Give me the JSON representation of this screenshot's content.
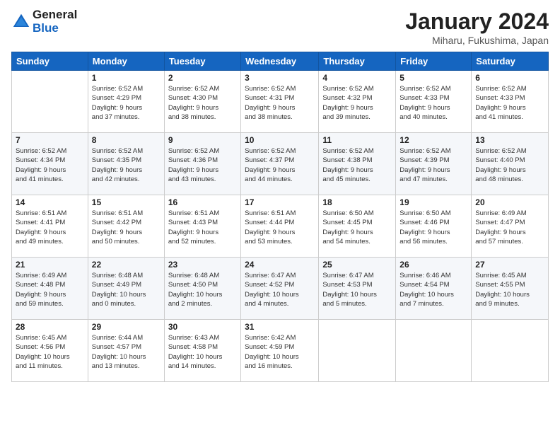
{
  "header": {
    "logo_line1": "General",
    "logo_line2": "Blue",
    "title": "January 2024",
    "subtitle": "Miharu, Fukushima, Japan"
  },
  "days_of_week": [
    "Sunday",
    "Monday",
    "Tuesday",
    "Wednesday",
    "Thursday",
    "Friday",
    "Saturday"
  ],
  "weeks": [
    [
      {
        "num": "",
        "info": ""
      },
      {
        "num": "1",
        "info": "Sunrise: 6:52 AM\nSunset: 4:29 PM\nDaylight: 9 hours\nand 37 minutes."
      },
      {
        "num": "2",
        "info": "Sunrise: 6:52 AM\nSunset: 4:30 PM\nDaylight: 9 hours\nand 38 minutes."
      },
      {
        "num": "3",
        "info": "Sunrise: 6:52 AM\nSunset: 4:31 PM\nDaylight: 9 hours\nand 38 minutes."
      },
      {
        "num": "4",
        "info": "Sunrise: 6:52 AM\nSunset: 4:32 PM\nDaylight: 9 hours\nand 39 minutes."
      },
      {
        "num": "5",
        "info": "Sunrise: 6:52 AM\nSunset: 4:33 PM\nDaylight: 9 hours\nand 40 minutes."
      },
      {
        "num": "6",
        "info": "Sunrise: 6:52 AM\nSunset: 4:33 PM\nDaylight: 9 hours\nand 41 minutes."
      }
    ],
    [
      {
        "num": "7",
        "info": "Sunrise: 6:52 AM\nSunset: 4:34 PM\nDaylight: 9 hours\nand 41 minutes."
      },
      {
        "num": "8",
        "info": "Sunrise: 6:52 AM\nSunset: 4:35 PM\nDaylight: 9 hours\nand 42 minutes."
      },
      {
        "num": "9",
        "info": "Sunrise: 6:52 AM\nSunset: 4:36 PM\nDaylight: 9 hours\nand 43 minutes."
      },
      {
        "num": "10",
        "info": "Sunrise: 6:52 AM\nSunset: 4:37 PM\nDaylight: 9 hours\nand 44 minutes."
      },
      {
        "num": "11",
        "info": "Sunrise: 6:52 AM\nSunset: 4:38 PM\nDaylight: 9 hours\nand 45 minutes."
      },
      {
        "num": "12",
        "info": "Sunrise: 6:52 AM\nSunset: 4:39 PM\nDaylight: 9 hours\nand 47 minutes."
      },
      {
        "num": "13",
        "info": "Sunrise: 6:52 AM\nSunset: 4:40 PM\nDaylight: 9 hours\nand 48 minutes."
      }
    ],
    [
      {
        "num": "14",
        "info": "Sunrise: 6:51 AM\nSunset: 4:41 PM\nDaylight: 9 hours\nand 49 minutes."
      },
      {
        "num": "15",
        "info": "Sunrise: 6:51 AM\nSunset: 4:42 PM\nDaylight: 9 hours\nand 50 minutes."
      },
      {
        "num": "16",
        "info": "Sunrise: 6:51 AM\nSunset: 4:43 PM\nDaylight: 9 hours\nand 52 minutes."
      },
      {
        "num": "17",
        "info": "Sunrise: 6:51 AM\nSunset: 4:44 PM\nDaylight: 9 hours\nand 53 minutes."
      },
      {
        "num": "18",
        "info": "Sunrise: 6:50 AM\nSunset: 4:45 PM\nDaylight: 9 hours\nand 54 minutes."
      },
      {
        "num": "19",
        "info": "Sunrise: 6:50 AM\nSunset: 4:46 PM\nDaylight: 9 hours\nand 56 minutes."
      },
      {
        "num": "20",
        "info": "Sunrise: 6:49 AM\nSunset: 4:47 PM\nDaylight: 9 hours\nand 57 minutes."
      }
    ],
    [
      {
        "num": "21",
        "info": "Sunrise: 6:49 AM\nSunset: 4:48 PM\nDaylight: 9 hours\nand 59 minutes."
      },
      {
        "num": "22",
        "info": "Sunrise: 6:48 AM\nSunset: 4:49 PM\nDaylight: 10 hours\nand 0 minutes."
      },
      {
        "num": "23",
        "info": "Sunrise: 6:48 AM\nSunset: 4:50 PM\nDaylight: 10 hours\nand 2 minutes."
      },
      {
        "num": "24",
        "info": "Sunrise: 6:47 AM\nSunset: 4:52 PM\nDaylight: 10 hours\nand 4 minutes."
      },
      {
        "num": "25",
        "info": "Sunrise: 6:47 AM\nSunset: 4:53 PM\nDaylight: 10 hours\nand 5 minutes."
      },
      {
        "num": "26",
        "info": "Sunrise: 6:46 AM\nSunset: 4:54 PM\nDaylight: 10 hours\nand 7 minutes."
      },
      {
        "num": "27",
        "info": "Sunrise: 6:45 AM\nSunset: 4:55 PM\nDaylight: 10 hours\nand 9 minutes."
      }
    ],
    [
      {
        "num": "28",
        "info": "Sunrise: 6:45 AM\nSunset: 4:56 PM\nDaylight: 10 hours\nand 11 minutes."
      },
      {
        "num": "29",
        "info": "Sunrise: 6:44 AM\nSunset: 4:57 PM\nDaylight: 10 hours\nand 13 minutes."
      },
      {
        "num": "30",
        "info": "Sunrise: 6:43 AM\nSunset: 4:58 PM\nDaylight: 10 hours\nand 14 minutes."
      },
      {
        "num": "31",
        "info": "Sunrise: 6:42 AM\nSunset: 4:59 PM\nDaylight: 10 hours\nand 16 minutes."
      },
      {
        "num": "",
        "info": ""
      },
      {
        "num": "",
        "info": ""
      },
      {
        "num": "",
        "info": ""
      }
    ]
  ]
}
